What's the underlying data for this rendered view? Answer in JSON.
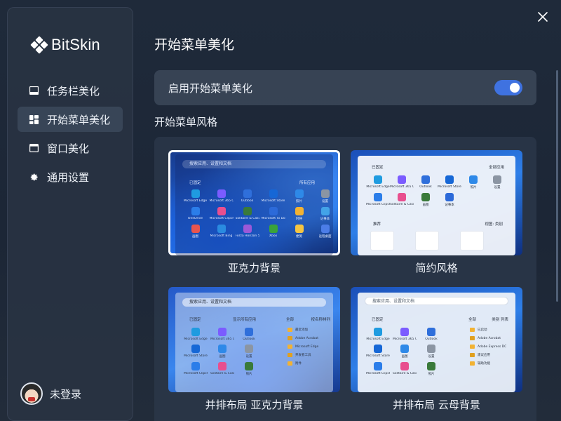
{
  "brand": {
    "name": "BitSkin"
  },
  "sidebar": {
    "items": [
      {
        "label": "任务栏美化",
        "icon": "taskbar-icon",
        "active": false
      },
      {
        "label": "开始菜单美化",
        "icon": "start-menu-icon",
        "active": true
      },
      {
        "label": "窗口美化",
        "icon": "window-icon",
        "active": false
      },
      {
        "label": "通用设置",
        "icon": "gear-icon",
        "active": false
      }
    ]
  },
  "user": {
    "label": "未登录",
    "icon": "avatar"
  },
  "header": {
    "title": "开始菜单美化"
  },
  "toggle": {
    "label": "启用开始菜单美化",
    "enabled": true
  },
  "section": {
    "title": "开始菜单风格"
  },
  "styles": [
    {
      "label": "亚克力背景",
      "selected": true,
      "search": "搜索应用、设置和文档",
      "pinned": "已固定",
      "all_apps": "所有应用",
      "apps": [
        "Microsoft Edge",
        "Microsoft 365 Copilot",
        "Outlook",
        "Microsoft Store",
        "照片",
        "设置",
        "OneDrive",
        "Microsoft Clipchamp",
        "Solitaire & Casual Games",
        "Microsoft To Do",
        "时钟",
        "记事本",
        "画图",
        "Microsoft Bing",
        "Forza Horizon 5",
        "Xbox",
        "便笺",
        "远程桌面"
      ]
    },
    {
      "label": "简约风格",
      "selected": false,
      "pinned": "已固定",
      "all_apps": "全部应用",
      "recommended": "推荐",
      "view": "视图: 类别",
      "apps": [
        "Microsoft Edge",
        "Microsoft 365 Copilot",
        "Outlook",
        "Microsoft Store",
        "照片",
        "设置",
        "Microsoft Clipchamp",
        "Solitaire & Casual Games",
        "画图",
        "记事本"
      ]
    },
    {
      "label": "并排布局 亚克力背景",
      "selected": false,
      "search": "搜索应用、设置和文档",
      "pinned": "已固定",
      "all_apps": "显示所有应用",
      "all_label": "全部",
      "sort": "按名称排列",
      "apps": [
        "Microsoft Edge",
        "Microsoft 365 Copilot",
        "Outlook",
        "Microsoft Store",
        "画图",
        "设置",
        "Microsoft Clipchamp",
        "Solitaire & Casual Games",
        "照片"
      ],
      "recent": [
        "最近添加",
        "Adobe Acrobat",
        "Microsoft Edge",
        "开发者工具",
        "附件"
      ]
    },
    {
      "label": "并排布局 云母背景",
      "selected": false,
      "search": "搜索应用、设置和文档",
      "pinned": "已固定",
      "all_apps": "全部",
      "sort": "类别 列表",
      "apps": [
        "Microsoft Edge",
        "Microsoft 365 Copilot",
        "Outlook",
        "Microsoft Store",
        "画图",
        "设置",
        "Microsoft Clipchamp",
        "Solitaire & Casual Games",
        "照片"
      ],
      "recent": [
        "已启动",
        "Adobe Acrobat",
        "Adobe Express DC",
        "建议应用",
        "辅助功能"
      ]
    }
  ],
  "colors": {
    "accent": "#3f72e0",
    "app_icons": [
      "#1f9be0",
      "#7b5cff",
      "#2f6fdb",
      "#1667d6",
      "#2e89e8",
      "#8b95a3",
      "#2b7de9",
      "#e84f8f",
      "#3a7a3a",
      "#2c6ad9",
      "#f2b233",
      "#43a3e8",
      "#e8554f",
      "#2a8be0",
      "#9b59d8",
      "#3aa33a",
      "#f5c542",
      "#4c7de8"
    ]
  }
}
